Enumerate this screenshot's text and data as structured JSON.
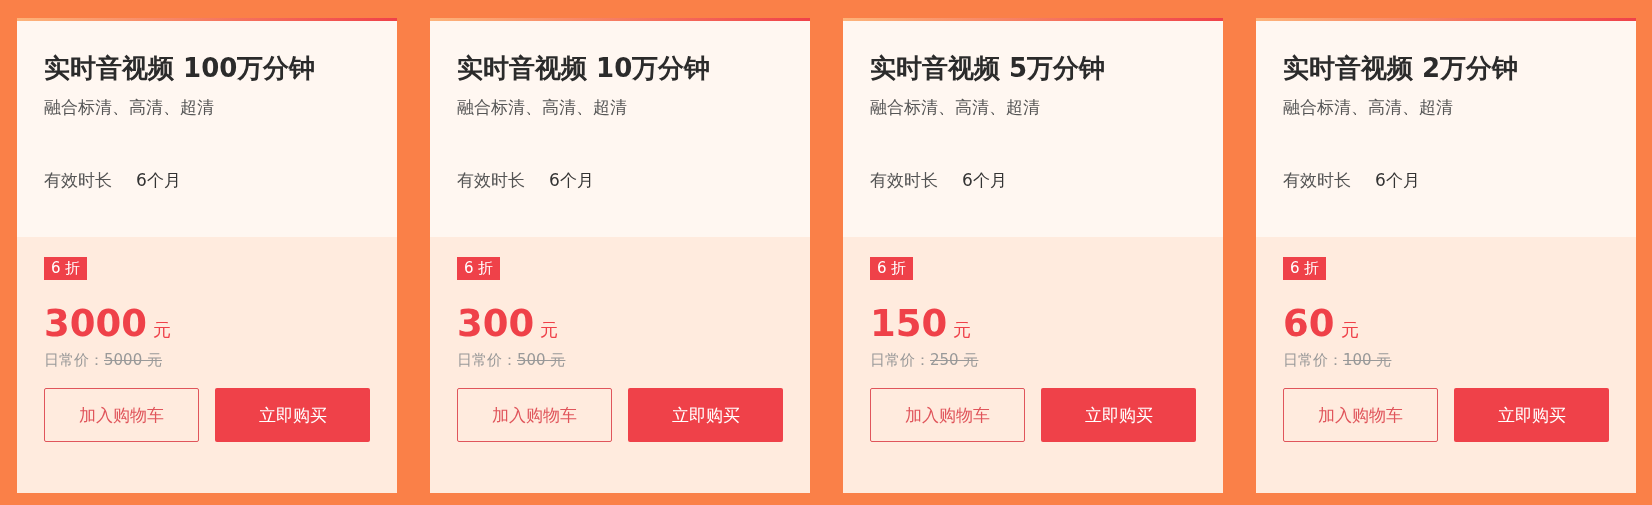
{
  "cards": [
    {
      "title": "实时音视频 100万分钟",
      "subtitle": "融合标清、高清、超清",
      "duration_label": "有效时长",
      "duration_value": "6个月",
      "discount": "6 折",
      "price": "3000",
      "price_unit": "元",
      "regular_label": "日常价：",
      "regular_price": "5000 元",
      "cart_button": "加入购物车",
      "buy_button": "立即购买"
    },
    {
      "title": "实时音视频 10万分钟",
      "subtitle": "融合标清、高清、超清",
      "duration_label": "有效时长",
      "duration_value": "6个月",
      "discount": "6 折",
      "price": "300",
      "price_unit": "元",
      "regular_label": "日常价：",
      "regular_price": "500 元",
      "cart_button": "加入购物车",
      "buy_button": "立即购买"
    },
    {
      "title": "实时音视频 5万分钟",
      "subtitle": "融合标清、高清、超清",
      "duration_label": "有效时长",
      "duration_value": "6个月",
      "discount": "6 折",
      "price": "150",
      "price_unit": "元",
      "regular_label": "日常价：",
      "regular_price": "250 元",
      "cart_button": "加入购物车",
      "buy_button": "立即购买"
    },
    {
      "title": "实时音视频 2万分钟",
      "subtitle": "融合标清、高清、超清",
      "duration_label": "有效时长",
      "duration_value": "6个月",
      "discount": "6 折",
      "price": "60",
      "price_unit": "元",
      "regular_label": "日常价：",
      "regular_price": "100 元",
      "cart_button": "加入购物车",
      "buy_button": "立即购买"
    }
  ]
}
